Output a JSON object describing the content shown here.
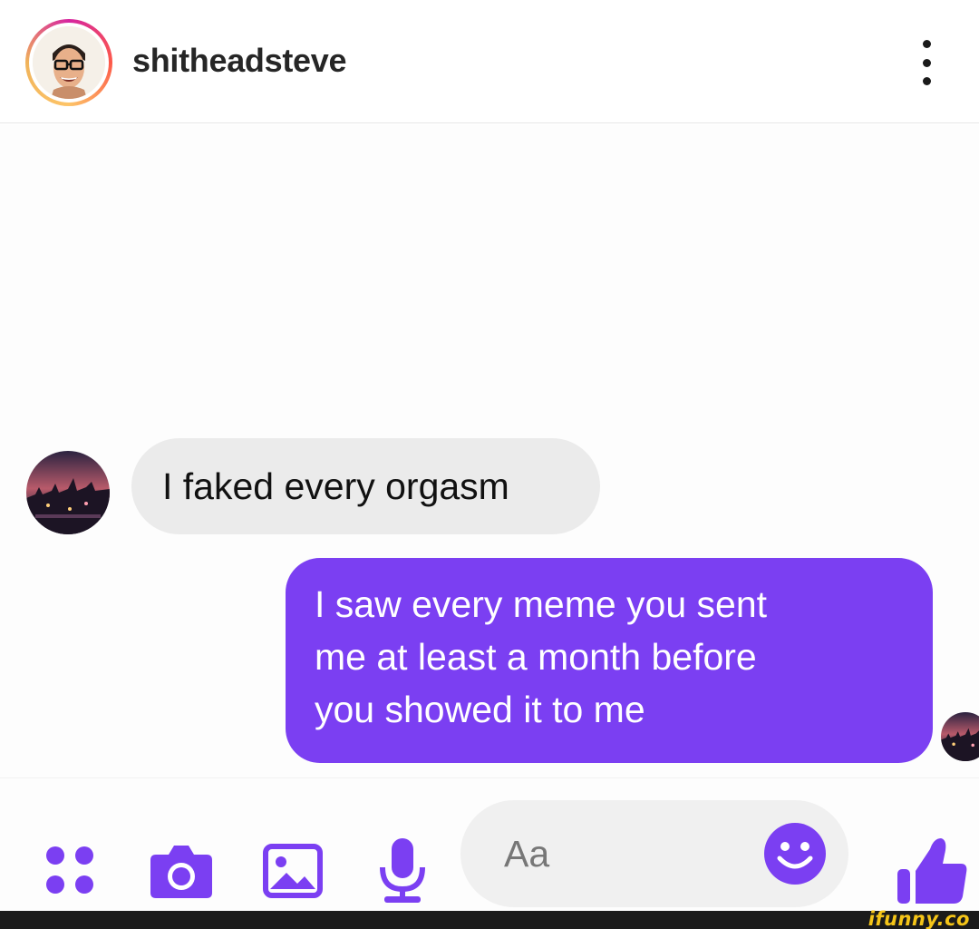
{
  "post": {
    "username": "shitheadsteve",
    "more_icon": "more-vertical-icon"
  },
  "conversation": {
    "messages": [
      {
        "direction": "incoming",
        "text": "I faked every orgasm"
      },
      {
        "direction": "outgoing",
        "lines": [
          "I saw every meme you sent",
          "me at least a month before",
          "you showed it to me"
        ]
      }
    ]
  },
  "composer": {
    "icons": [
      "apps-icon",
      "camera-icon",
      "image-icon",
      "microphone-icon",
      "emoji-icon",
      "thumbs-up-icon"
    ],
    "placeholder": "Aa"
  },
  "colors": {
    "accent": "#7b3ff2",
    "incoming_bubble": "#ebebeb",
    "outgoing_text": "#ffffff"
  },
  "watermark": "ifunny.co"
}
